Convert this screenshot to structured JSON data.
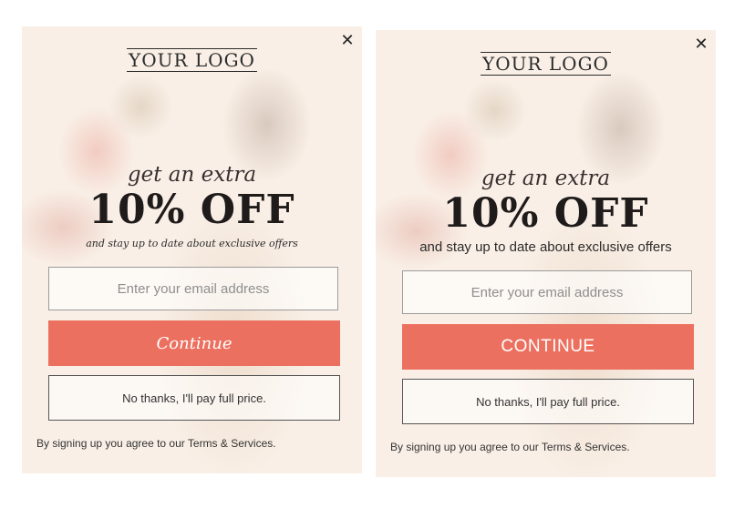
{
  "variants": [
    {
      "close_icon": "✕",
      "logo": "YOUR LOGO",
      "headline_small": "get an extra",
      "headline_big": "10% OFF",
      "subtitle": "and stay up to date about exclusive offers",
      "email_placeholder": "Enter your email address",
      "continue_label": "Continue",
      "decline_label": "No thanks, I'll pay full price.",
      "terms": "By signing up you agree to our Terms & Services."
    },
    {
      "close_icon": "✕",
      "logo": "YOUR LOGO",
      "headline_small": "get an extra",
      "headline_big": "10% OFF",
      "subtitle": "and stay up to date about exclusive offers",
      "email_placeholder": "Enter your email address",
      "continue_label": "CONTINUE",
      "decline_label": "No thanks, I'll pay full price.",
      "terms": "By signing up you agree to our Terms & Services."
    }
  ],
  "colors": {
    "accent": "#ec705f",
    "background": "#f9efe6",
    "text_dark": "#1f1b1b"
  }
}
